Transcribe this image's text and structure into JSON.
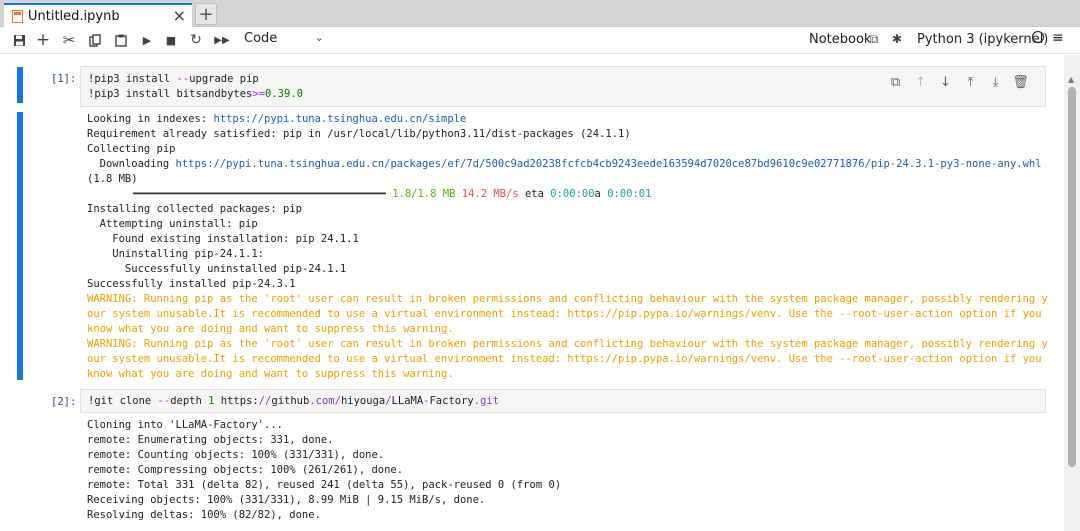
{
  "tab": {
    "title": "Untitled.ipynb",
    "close": "×",
    "add": "+"
  },
  "toolbar": {
    "cell_type": "Code",
    "notebook_label": "Notebook",
    "kernel_name": "Python 3 (ipykernel)"
  },
  "cells": [
    {
      "prompt": "[1]:",
      "code": [
        "!pip3 install --upgrade pip",
        "!pip3 install bitsandbytes>=0.39.0"
      ],
      "output": [
        "Looking in indexes: ",
        "https://pypi.tuna.tsinghua.edu.cn/simple",
        "Requirement already satisfied: pip in /usr/local/lib/python3.11/dist-packages (24.1.1)",
        "Collecting pip",
        "  Downloading ",
        "https://pypi.tuna.tsinghua.edu.cn/packages/ef/7d/500c9ad20238fcfcb4cb9243eede163594d7020ce87bd9610c9e02771876/pip-24.3.1-py3-none-any.whl",
        "(1.8 MB)",
        "━━━━━━━━━━━━━━━━━━━━━━━━━━━━━━━━━━━━━━━━",
        "1.8/1.8 MB",
        "14.2 MB/s",
        "eta",
        "0:00:00",
        "a",
        "0:00:01",
        "Installing collected packages: pip",
        "  Attempting uninstall: pip",
        "    Found existing installation: pip 24.1.1",
        "    Uninstalling pip-24.1.1:",
        "      Successfully uninstalled pip-24.1.1",
        "Successfully installed pip-24.3.1",
        "WARNING: Running pip as the 'root' user can result in broken permissions and conflicting behaviour with the system package manager, possibly rendering y",
        "our system unusable.It is recommended to use a virtual environment instead: https://pip.pypa.io/warnings/venv. Use the --root-user-action option if you",
        "know what you are doing and want to suppress this warning."
      ]
    },
    {
      "prompt": "[2]:",
      "code": [
        "!git clone --depth 1 https://github.com/hiyouga/LLaMA-Factory.git"
      ],
      "output": [
        "Cloning into 'LLaMA-Factory'...",
        "remote: Enumerating objects: 331, done.",
        "remote: Counting objects: 100% (331/331), done.",
        "remote: Compressing objects: 100% (261/261), done.",
        "remote: Total 331 (delta 82), reused 241 (delta 55), pack-reused 0 (from 0)",
        "Receiving objects: 100% (331/331), 8.99 MiB | 9.15 MiB/s, done.",
        "Resolving deltas: 100% (82/82), done."
      ]
    }
  ],
  "colors": {
    "accent": "#1976d2",
    "warning": "#f0a000",
    "link": "#1a5fb4"
  }
}
